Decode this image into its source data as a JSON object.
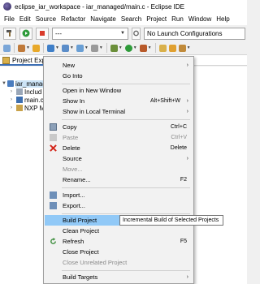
{
  "window": {
    "title": "eclipse_iar_workspace - iar_managed/main.c - Eclipse IDE"
  },
  "menubar": [
    "File",
    "Edit",
    "Source",
    "Refactor",
    "Navigate",
    "Search",
    "Project",
    "Run",
    "Window",
    "Help"
  ],
  "toolbar": {
    "mode_value": "---",
    "launch_config": "No Launch Configurations"
  },
  "explorer": {
    "title": "Project Explo"
  },
  "tree": {
    "project": "iar_manag",
    "children": [
      "Includ",
      "main.c",
      "NXP M"
    ]
  },
  "context_menu": {
    "items": [
      {
        "label": "New",
        "submenu": true
      },
      {
        "label": "Go Into"
      },
      {
        "label": "Open in New Window"
      },
      {
        "label": "Show In",
        "shortcut": "Alt+Shift+W",
        "submenu": true
      },
      {
        "label": "Show in Local Terminal",
        "submenu": true
      },
      {
        "label": "Copy",
        "shortcut": "Ctrl+C"
      },
      {
        "label": "Paste",
        "shortcut": "Ctrl+V",
        "disabled": true
      },
      {
        "label": "Delete",
        "shortcut": "Delete"
      },
      {
        "label": "Source",
        "submenu": true
      },
      {
        "label": "Move...",
        "disabled": true
      },
      {
        "label": "Rename...",
        "shortcut": "F2"
      },
      {
        "label": "Import..."
      },
      {
        "label": "Export..."
      },
      {
        "label": "Build Project",
        "highlighted": true
      },
      {
        "label": "Clean Project"
      },
      {
        "label": "Refresh",
        "shortcut": "F5"
      },
      {
        "label": "Close Project"
      },
      {
        "label": "Close Unrelated Project",
        "disabled": true
      },
      {
        "label": "Build Targets",
        "submenu": true
      }
    ]
  },
  "tooltip": {
    "text": "Incremental Build of Selected Projects"
  },
  "colors": {
    "highlight": "#91c9f7",
    "selection": "#cce4f7",
    "accent": "#3c6eb4"
  }
}
